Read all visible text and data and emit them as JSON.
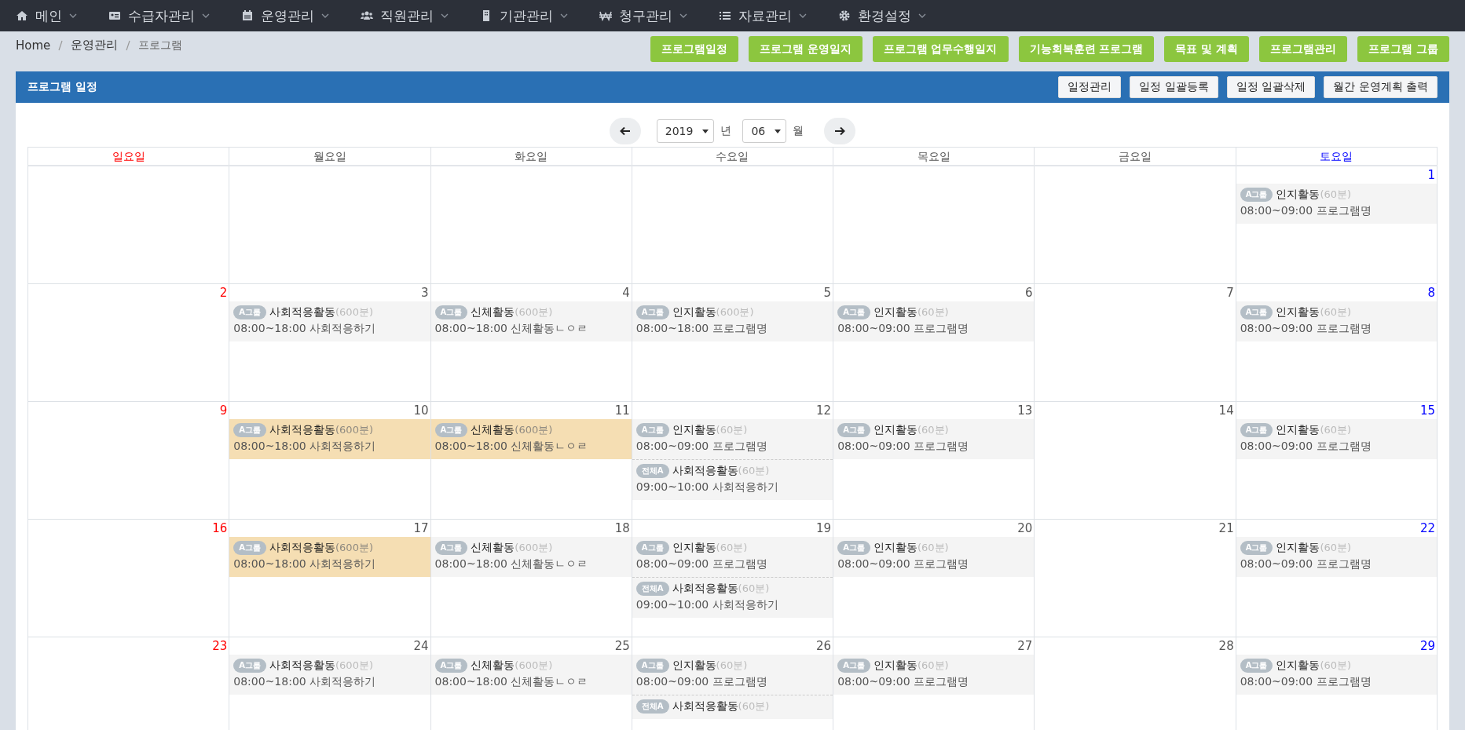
{
  "nav": [
    {
      "label": "메인"
    },
    {
      "label": "수급자관리"
    },
    {
      "label": "운영관리"
    },
    {
      "label": "직원관리"
    },
    {
      "label": "기관관리"
    },
    {
      "label": "청구관리"
    },
    {
      "label": "자료관리"
    },
    {
      "label": "환경설정"
    }
  ],
  "breadcrumb": [
    "Home",
    "운영관리",
    "프로그램"
  ],
  "top_buttons": [
    "프로그램일정",
    "프로그램 운영일지",
    "프로그램 업무수행일지",
    "기능회복훈련 프로그램",
    "목표 및 계획",
    "프로그램관리",
    "프로그램 그룹"
  ],
  "panel": {
    "title": "프로그램 일정",
    "buttons": [
      "일정관리",
      "일정 일괄등록",
      "일정 일괄삭제",
      "월간 운영계획 출력"
    ]
  },
  "month_nav": {
    "year": "2019",
    "year_unit": "년",
    "month": "06",
    "month_unit": "월"
  },
  "weekdays": [
    "일요일",
    "월요일",
    "화요일",
    "수요일",
    "목요일",
    "금요일",
    "토요일"
  ],
  "weeks": [
    [
      {
        "day": "1",
        "events": [
          {
            "badge": "A그룹",
            "title": "인지활동",
            "duration": "(60분)",
            "time": "08:00~09:00 프로그램명",
            "highlighted": false
          }
        ]
      }
    ],
    [
      {
        "day": "2"
      },
      {
        "day": "3",
        "events": [
          {
            "badge": "A그룹",
            "title": "사회적응활동",
            "duration": "(600분)",
            "time": "08:00~18:00 사회적응하기",
            "highlighted": false
          }
        ]
      },
      {
        "day": "4",
        "events": [
          {
            "badge": "A그룹",
            "title": "신체활동",
            "duration": "(600분)",
            "time": "08:00~18:00 신체활동ㄴㅇㄹ",
            "highlighted": false
          }
        ]
      },
      {
        "day": "5",
        "events": [
          {
            "badge": "A그룹",
            "title": "인지활동",
            "duration": "(600분)",
            "time": "08:00~18:00 프로그램명",
            "highlighted": false
          }
        ]
      },
      {
        "day": "6",
        "events": [
          {
            "badge": "A그룹",
            "title": "인지활동",
            "duration": "(60분)",
            "time": "08:00~09:00 프로그램명",
            "highlighted": false
          }
        ]
      },
      {
        "day": "7"
      },
      {
        "day": "8",
        "events": [
          {
            "badge": "A그룹",
            "title": "인지활동",
            "duration": "(60분)",
            "time": "08:00~09:00 프로그램명",
            "highlighted": false
          }
        ]
      }
    ],
    [
      {
        "day": "9"
      },
      {
        "day": "10",
        "events": [
          {
            "badge": "A그룹",
            "title": "사회적응활동",
            "duration": "(600분)",
            "time": "08:00~18:00 사회적응하기",
            "highlighted": true
          }
        ]
      },
      {
        "day": "11",
        "events": [
          {
            "badge": "A그룹",
            "title": "신체활동",
            "duration": "(600분)",
            "time": "08:00~18:00 신체활동ㄴㅇㄹ",
            "highlighted": true
          }
        ]
      },
      {
        "day": "12",
        "events": [
          {
            "badge": "A그룹",
            "title": "인지활동",
            "duration": "(60분)",
            "time": "08:00~09:00 프로그램명",
            "highlighted": false
          },
          {
            "badge": "전체A",
            "title": "사회적응활동",
            "duration": "(60분)",
            "time": "09:00~10:00 사회적응하기",
            "highlighted": false
          }
        ]
      },
      {
        "day": "13",
        "events": [
          {
            "badge": "A그룹",
            "title": "인지활동",
            "duration": "(60분)",
            "time": "08:00~09:00 프로그램명",
            "highlighted": false
          }
        ]
      },
      {
        "day": "14"
      },
      {
        "day": "15",
        "events": [
          {
            "badge": "A그룹",
            "title": "인지활동",
            "duration": "(60분)",
            "time": "08:00~09:00 프로그램명",
            "highlighted": false
          }
        ]
      }
    ],
    [
      {
        "day": "16"
      },
      {
        "day": "17",
        "events": [
          {
            "badge": "A그룹",
            "title": "사회적응활동",
            "duration": "(600분)",
            "time": "08:00~18:00 사회적응하기",
            "highlighted": true
          }
        ]
      },
      {
        "day": "18",
        "events": [
          {
            "badge": "A그룹",
            "title": "신체활동",
            "duration": "(600분)",
            "time": "08:00~18:00 신체활동ㄴㅇㄹ",
            "highlighted": false
          }
        ]
      },
      {
        "day": "19",
        "events": [
          {
            "badge": "A그룹",
            "title": "인지활동",
            "duration": "(60분)",
            "time": "08:00~09:00 프로그램명",
            "highlighted": false
          },
          {
            "badge": "전체A",
            "title": "사회적응활동",
            "duration": "(60분)",
            "time": "09:00~10:00 사회적응하기",
            "highlighted": false
          }
        ]
      },
      {
        "day": "20",
        "events": [
          {
            "badge": "A그룹",
            "title": "인지활동",
            "duration": "(60분)",
            "time": "08:00~09:00 프로그램명",
            "highlighted": false
          }
        ]
      },
      {
        "day": "21"
      },
      {
        "day": "22",
        "events": [
          {
            "badge": "A그룹",
            "title": "인지활동",
            "duration": "(60분)",
            "time": "08:00~09:00 프로그램명",
            "highlighted": false
          }
        ]
      }
    ],
    [
      {
        "day": "23"
      },
      {
        "day": "24",
        "events": [
          {
            "badge": "A그룹",
            "title": "사회적응활동",
            "duration": "(600분)",
            "time": "08:00~18:00 사회적응하기",
            "highlighted": false
          }
        ]
      },
      {
        "day": "25",
        "events": [
          {
            "badge": "A그룹",
            "title": "신체활동",
            "duration": "(600분)",
            "time": "08:00~18:00 신체활동ㄴㅇㄹ",
            "highlighted": false
          }
        ]
      },
      {
        "day": "26",
        "events": [
          {
            "badge": "A그룹",
            "title": "인지활동",
            "duration": "(60분)",
            "time": "08:00~09:00 프로그램명",
            "highlighted": false
          },
          {
            "badge": "전체A",
            "title": "사회적응활동",
            "duration": "(60분)",
            "highlighted": false
          }
        ]
      },
      {
        "day": "27",
        "events": [
          {
            "badge": "A그룹",
            "title": "인지활동",
            "duration": "(60분)",
            "time": "08:00~09:00 프로그램명",
            "highlighted": false
          }
        ]
      },
      {
        "day": "28"
      },
      {
        "day": "29",
        "events": [
          {
            "badge": "A그룹",
            "title": "인지활동",
            "duration": "(60분)",
            "time": "08:00~09:00 프로그램명",
            "highlighted": false
          }
        ]
      }
    ]
  ]
}
